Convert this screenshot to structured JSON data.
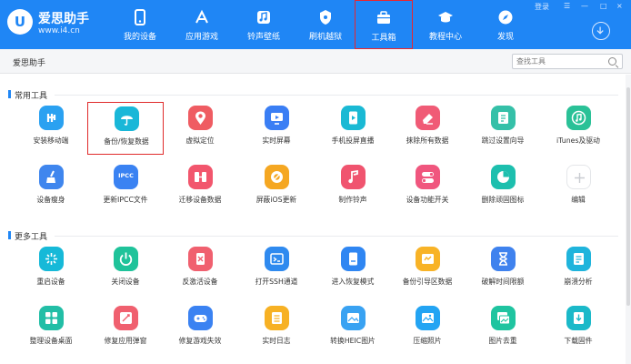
{
  "header": {
    "logo_initial": "U",
    "logo_name": "爱思助手",
    "logo_url": "www.i4.cn",
    "nav": [
      {
        "label": "我的设备",
        "icon": "phone-icon"
      },
      {
        "label": "应用游戏",
        "icon": "app-store-icon"
      },
      {
        "label": "铃声壁纸",
        "icon": "music-icon"
      },
      {
        "label": "刷机越狱",
        "icon": "shield-icon"
      },
      {
        "label": "工具箱",
        "icon": "toolbox-icon",
        "active": true
      },
      {
        "label": "教程中心",
        "icon": "graduation-cap-icon"
      },
      {
        "label": "发现",
        "icon": "compass-icon"
      }
    ],
    "login_label": "登录",
    "window_controls": [
      "☰",
      "—",
      "□",
      "×"
    ]
  },
  "subbar": {
    "title": "爱思助手",
    "search_placeholder": "查找工具"
  },
  "sections": [
    {
      "title": "常用工具",
      "tools": [
        {
          "label": "安装移动端",
          "icon": "install-icon",
          "color": "#2aa1f1"
        },
        {
          "label": "备份/恢复数据",
          "icon": "umbrella-icon",
          "color": "#19b7d8",
          "highlight": true
        },
        {
          "label": "虚拟定位",
          "icon": "location-pin-icon",
          "color": "#ef5c62"
        },
        {
          "label": "实时屏幕",
          "icon": "screen-share-icon",
          "color": "#3a7ef4"
        },
        {
          "label": "手机投屏直播",
          "icon": "play-video-icon",
          "color": "#1ab9d4"
        },
        {
          "label": "抹除所有数据",
          "icon": "eraser-icon",
          "color": "#f05b76"
        },
        {
          "label": "跳过设置向导",
          "icon": "skip-guide-icon",
          "color": "#35c0a8"
        },
        {
          "label": "iTunes及驱动",
          "icon": "itunes-icon",
          "color": "#2ac197"
        },
        {
          "label": "设备瘦身",
          "icon": "broom-icon",
          "color": "#3f86ee"
        },
        {
          "label": "更新IPCC文件",
          "icon": "ipcc-icon",
          "color": "#3a82f2",
          "icon_text": "IPCC"
        },
        {
          "label": "迁移设备数据",
          "icon": "transfer-icon",
          "color": "#f2566d"
        },
        {
          "label": "屏蔽iOS更新",
          "icon": "gear-block-icon",
          "color": "#f5a722"
        },
        {
          "label": "制作铃声",
          "icon": "music-note-icon",
          "color": "#f0546f"
        },
        {
          "label": "设备功能开关",
          "icon": "toggle-icon",
          "color": "#f0567e"
        },
        {
          "label": "删除顽固图标",
          "icon": "pie-icon",
          "color": "#1dbfae"
        },
        {
          "label": "编辑",
          "icon": "plus-icon",
          "color": "#ffffff"
        }
      ]
    },
    {
      "title": "更多工具",
      "tools": [
        {
          "label": "重启设备",
          "icon": "restart-icon",
          "color": "#16b9d8"
        },
        {
          "label": "关闭设备",
          "icon": "power-icon",
          "color": "#1fc39a"
        },
        {
          "label": "反激活设备",
          "icon": "deactivate-icon",
          "color": "#f0606f"
        },
        {
          "label": "打开SSH通道",
          "icon": "terminal-icon",
          "color": "#2f8aef"
        },
        {
          "label": "进入恢复模式",
          "icon": "recovery-icon",
          "color": "#2f86f2"
        },
        {
          "label": "备份引导区数据",
          "icon": "backup-boot-icon",
          "color": "#f8b327"
        },
        {
          "label": "破解时间限额",
          "icon": "hourglass-icon",
          "color": "#3f82ee"
        },
        {
          "label": "崩溃分析",
          "icon": "crash-report-icon",
          "color": "#1fb4dc"
        },
        {
          "label": "整理设备桌面",
          "icon": "grid-icon",
          "color": "#22bea6"
        },
        {
          "label": "修复应用弹窗",
          "icon": "repair-app-icon",
          "color": "#f0606f"
        },
        {
          "label": "修复游戏失效",
          "icon": "gamepad-icon",
          "color": "#3a82f2"
        },
        {
          "label": "实时日志",
          "icon": "log-icon",
          "color": "#f7b124"
        },
        {
          "label": "转换HEIC图片",
          "icon": "image-convert-icon",
          "color": "#39a2f2"
        },
        {
          "label": "压缩照片",
          "icon": "compress-photo-icon",
          "color": "#23a4f3"
        },
        {
          "label": "图片去重",
          "icon": "photo-dedup-icon",
          "color": "#1fc4a0"
        },
        {
          "label": "下载固件",
          "icon": "download-firmware-icon",
          "color": "#1bb9c9"
        }
      ]
    }
  ]
}
